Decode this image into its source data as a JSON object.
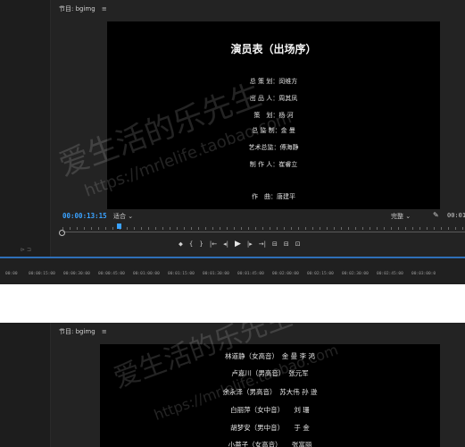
{
  "top": {
    "panel_tab": "节目: bgimg",
    "panel_menu_glyph": "≡",
    "video": {
      "title": "演员表（出场序）",
      "credits": [
        "总 策 划：闵维方",
        "出 品 人：周其凤",
        "策　划：杨 河",
        "总 监 制：金 曼",
        "艺术总监：傅海静",
        "制 作 人：崔睿立",
        "作　曲：唐建平"
      ]
    },
    "timecode": "00:00:13:15",
    "fit_label": "适合",
    "quality_label": "完整",
    "duration": "00:01",
    "transport": [
      "⬥",
      "{",
      "}",
      "|←",
      "◂|",
      "▶",
      "|▸",
      "→|",
      "⊟",
      "⊟",
      "⊡"
    ],
    "left_icons": "⊳ ⊐",
    "timeline_labels": [
      "00:00",
      "00:00:15:00",
      "00:00:30:00",
      "00:00:45:00",
      "00:01:00:00",
      "00:01:15:00",
      "00:01:30:00",
      "00:01:45:00",
      "00:02:00:00",
      "00:02:15:00",
      "00:02:30:00",
      "00:02:45:00",
      "00:03:00:0"
    ]
  },
  "bottom": {
    "panel_tab": "节目: bgimg",
    "panel_menu_glyph": "≡",
    "cast": [
      "林道静（女高音）　金 曼 李 鸿",
      "卢嘉川（男高音）　张元军",
      "余永泽（男高音）　苏大伟 孙 逊",
      "白丽萍（女中音）　　刘 珊",
      "胡梦安（男中音）　　于 金",
      "小蒂子（女高音）　　张富丽"
    ]
  },
  "watermarks": [
    "爱生活的乐先生",
    "https://mrlelife.taobao.com",
    "爱生活的乐先生",
    "https://mrlelife.taobao.com"
  ]
}
